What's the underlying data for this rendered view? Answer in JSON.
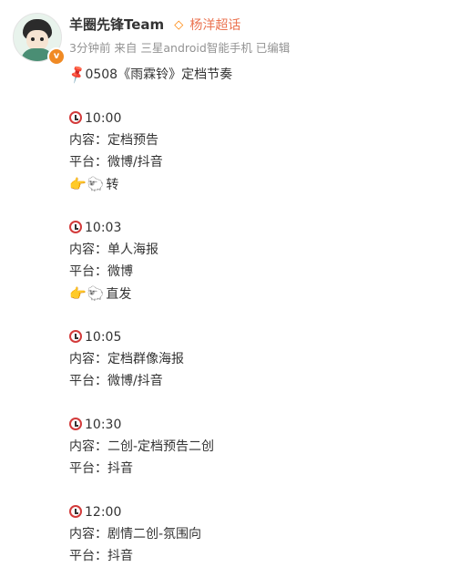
{
  "post": {
    "user_name": "羊圈先锋Team",
    "super_topic": "杨洋超话",
    "meta": "3分钟前  来自 三星android智能手机 已编辑",
    "title": "0508《雨霖铃》定档节奏",
    "schedule": [
      {
        "time": "10:00",
        "content": "内容：定档预告",
        "platform": "平台：微博/抖音",
        "extra": "转"
      },
      {
        "time": "10:03",
        "content": "内容：单人海报",
        "platform": "平台：微博",
        "extra": "直发"
      },
      {
        "time": "10:05",
        "content": "内容：定档群像海报",
        "platform": "平台：微博/抖音"
      },
      {
        "time": "10:30",
        "content": "内容：二创-定档预告二创",
        "platform": "平台：抖音"
      },
      {
        "time": "12:00",
        "content": "内容：剧情二创-氛围向",
        "platform": "平台：抖音"
      }
    ]
  },
  "icons": {
    "pin": "pushpin-icon",
    "clock": "alarm-clock-icon",
    "pointing": "pointing-right-icon",
    "sheep": "sheep-icon",
    "super_topic": "diamond-icon",
    "verified": "verified-badge-icon"
  },
  "colors": {
    "accent_orange": "#eb7350",
    "meta_gray": "#939393",
    "text": "#333333"
  }
}
